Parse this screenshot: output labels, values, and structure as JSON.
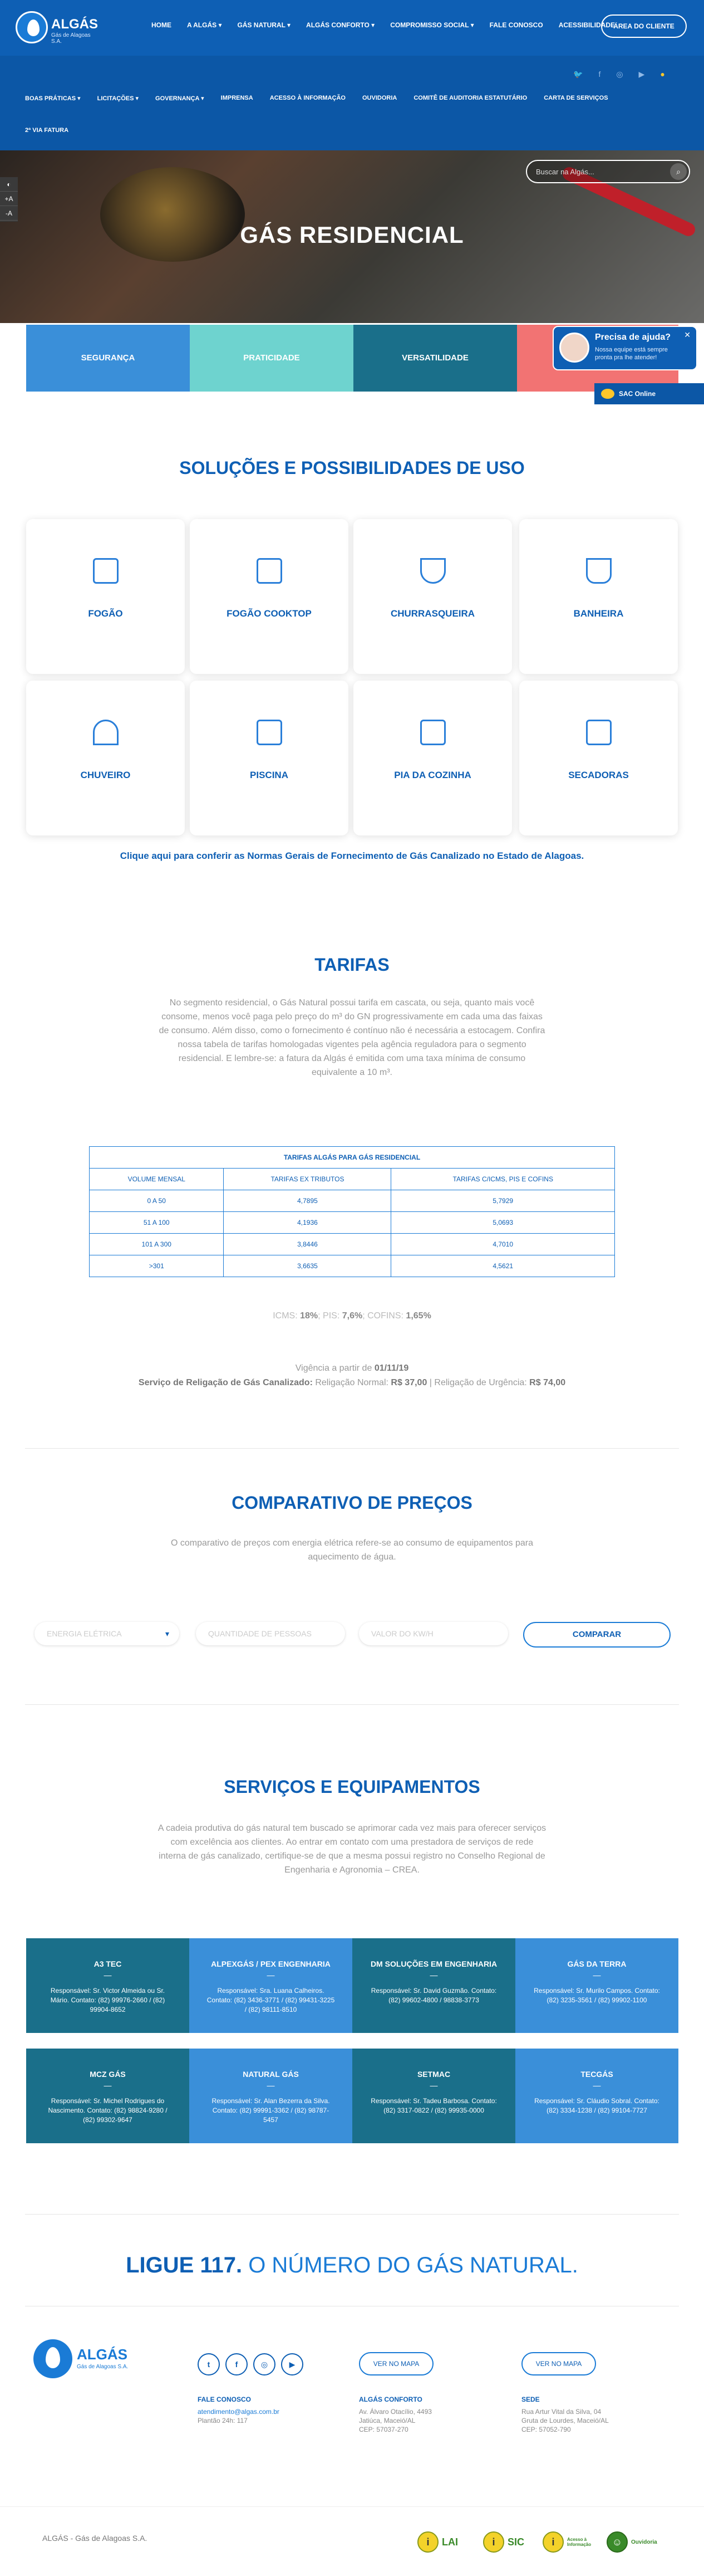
{
  "header": {
    "logo_name": "ALGÁS",
    "logo_sub": "Gás de Alagoas S.A.",
    "nav": [
      "HOME",
      "A ALGÁS ▾",
      "GÁS NATURAL ▾",
      "ALGÁS CONFORTO ▾",
      "COMPROMISSO SOCIAL ▾",
      "FALE CONOSCO",
      "ACESSIBILIDADE"
    ],
    "client_area": "ÁREA DO CLIENTE",
    "social": [
      "twitter-icon",
      "facebook-icon",
      "instagram-icon",
      "youtube-icon",
      "info-icon"
    ],
    "subnav": [
      "BOAS PRÁTICAS ▾",
      "LICITAÇÕES ▾",
      "GOVERNANÇA ▾",
      "IMPRENSA",
      "ACESSO À INFORMAÇÃO",
      "OUVIDORIA",
      "COMITÊ DE AUDITORIA ESTATUTÁRIO",
      "CARTA DE SERVIÇOS"
    ],
    "subnav2": "2ª VIA FATURA"
  },
  "hero": {
    "title": "GÁS RESIDENCIAL",
    "search_placeholder": "Buscar na Algás...",
    "features": [
      "SEGURANÇA",
      "PRATICIDADE",
      "VERSATILIDADE",
      ""
    ],
    "feature_colors": [
      "#3a8fd9",
      "#6ed3cf",
      "#1a6f8a",
      "#f27373"
    ]
  },
  "chat": {
    "title": "Precisa de ajuda?",
    "subtitle": "Nossa equipe está sempre pronta pra lhe atender!",
    "sac": "SAC Online"
  },
  "solucoes": {
    "title": "SOLUÇÕES E POSSIBILIDADES DE USO",
    "items": [
      "FOGÃO",
      "FOGÃO COOKTOP",
      "CHURRASQUEIRA",
      "BANHEIRA",
      "CHUVEIRO",
      "PISCINA",
      "PIA DA COZINHA",
      "SECADORAS"
    ],
    "link": "Clique aqui para conferir as Normas Gerais de Fornecimento de Gás Canalizado no Estado de Alagoas."
  },
  "tarifas": {
    "title": "TARIFAS",
    "text": "No segmento residencial, o Gás Natural possui tarifa em cascata, ou seja, quanto mais você consome, menos você paga pelo preço do m³ do GN progressivamente em cada uma das faixas de consumo. Além disso, como o fornecimento é contínuo não é necessária a estocagem. Confira nossa tabela de tarifas homologadas vigentes pela agência reguladora para o segmento residencial. E lembre-se: a fatura da Algás é emitida com uma taxa mínima de consumo equivalente a 10 m³.",
    "table_caption": "TARIFAS ALGÁS PARA GÁS RESIDENCIAL",
    "columns": [
      "VOLUME MENSAL",
      "TARIFAS EX TRIBUTOS",
      "TARIFAS C/ICMS, PIS E COFINS"
    ],
    "rows": [
      [
        "0 A 50",
        "4,7895",
        "5,7929"
      ],
      [
        "51 A 100",
        "4,1936",
        "5,0693"
      ],
      [
        "101 A 300",
        "3,8446",
        "4,7010"
      ],
      [
        ">301",
        "3,6635",
        "4,5621"
      ]
    ],
    "taxes_icms_label": "ICMS:",
    "taxes_icms": "18%",
    "taxes_pis_label": "; PIS:",
    "taxes_pis": "7,6%",
    "taxes_cofins_label": "; COFINS:",
    "taxes_cofins": "1,65%",
    "vig_label": "Vigência a partir de",
    "vig_date": "01/11/19",
    "relig_label": "Serviço de Religação de Gás Canalizado:",
    "relig_normal_label": "Religação Normal:",
    "relig_normal": "R$ 37,00",
    "relig_urg_label": "| Religação de Urgência:",
    "relig_urg": "R$ 74,00"
  },
  "comparativo": {
    "title": "COMPARATIVO DE PREÇOS",
    "text": "O comparativo de preços com energia elétrica refere-se ao consumo de equipamentos para aquecimento de água.",
    "select": "ENERGIA ELÉTRICA",
    "qty_placeholder": "QUANTIDADE DE PESSOAS",
    "kwh_placeholder": "VALOR DO KW/H",
    "button": "COMPARAR"
  },
  "servicos": {
    "title": "SERVIÇOS E EQUIPAMENTOS",
    "text": "A cadeia produtiva do gás natural tem buscado se aprimorar cada vez mais para oferecer serviços com excelência aos clientes. Ao entrar em contato com uma prestadora de serviços de rede interna de gás canalizado, certifique-se de que a mesma possui registro no Conselho Regional de Engenharia e Agronomia – CREA.",
    "colors": [
      "#1a6f8a",
      "#3a8fd9"
    ],
    "items": [
      {
        "name": "A3 TEC",
        "info": "Responsável: Sr. Victor Almeida ou Sr. Mário. Contato: (82) 99976-2660 / (82) 99904-8652"
      },
      {
        "name": "ALPEXGÁS / PEX ENGENHARIA",
        "info": "Responsável: Sra. Luana Calheiros. Contato: (82) 3436-3771 / (82) 99431-3225 / (82) 98111-8510"
      },
      {
        "name": "DM SOLUÇÕES EM ENGENHARIA",
        "info": "Responsável: Sr. David Guzmão. Contato: (82) 99602-4800 / 98838-3773"
      },
      {
        "name": "GÁS DA TERRA",
        "info": "Responsável: Sr. Murilo Campos. Contato: (82) 3235-3561 / (82) 99902-1100"
      },
      {
        "name": "MCZ GÁS",
        "info": "Responsável: Sr. Michel Rodrigues do Nascimento. Contato: (82) 98824-9280 / (82) 99302-9647"
      },
      {
        "name": "NATURAL GÁS",
        "info": "Responsável: Sr. Alan Bezerra da Silva. Contato: (82) 99991-3362 / (82) 98787-5457"
      },
      {
        "name": "SETMAC",
        "info": "Responsável: Sr. Tadeu Barbosa. Contato: (82) 3317-0822 / (82) 99935-0000"
      },
      {
        "name": "TECGÁS",
        "info": "Responsável: Sr. Cláudio Sobral. Contato: (82) 3334-1238 / (82) 99104-7727"
      }
    ]
  },
  "ligue": {
    "bold": "LIGUE 117.",
    "rest": " O NÚMERO DO GÁS NATURAL."
  },
  "footer": {
    "logo_name": "ALGÁS",
    "logo_sub": "Gás de Alagoas S.A.",
    "social": [
      "t",
      "f",
      "◎",
      "▶"
    ],
    "map_btn": "VER NO MAPA",
    "fale_title": "FALE CONOSCO",
    "fale_email": "atendimento@algas.com.br",
    "fale_plantao": "Plantão 24h: 117",
    "conf_title": "ALGÁS CONFORTO",
    "conf_addr": "Av. Álvaro Otacílio, 4493",
    "conf_city": "Jatiúca, Maceió/AL",
    "conf_cep": "CEP: 57037-270",
    "sede_title": "SEDE",
    "sede_addr": "Rua Artur Vital da Silva, 04",
    "sede_city": "Gruta de Lourdes, Maceió/AL",
    "sede_cep": "CEP: 57052-790",
    "copyright": "ALGÁS - Gás de Alagoas S.A.",
    "badges": [
      "LAI",
      "SIC",
      "Acesso à Informação",
      "Ouvidoria"
    ]
  }
}
